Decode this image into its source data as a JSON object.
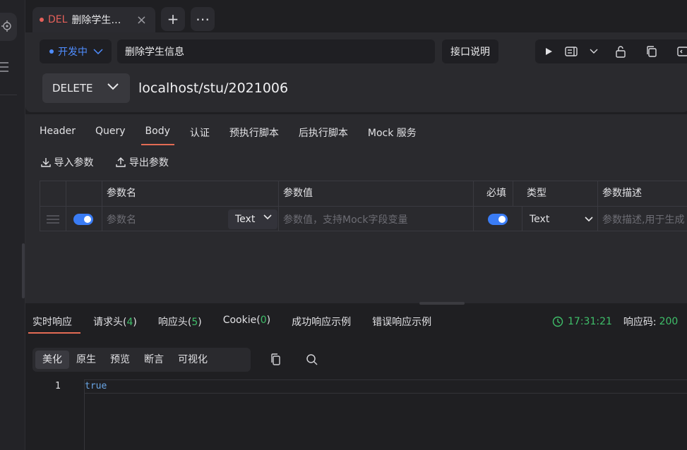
{
  "tab": {
    "method": "DEL",
    "name": "删除学生…",
    "close_icon": "×"
  },
  "tab_actions": {
    "add": "+",
    "more": "⋯"
  },
  "request": {
    "status": "开发中",
    "name_value": "删除学生信息",
    "doc_button": "接口说明",
    "http_method": "DELETE",
    "url_value": "localhost/stu/2021006"
  },
  "subtabs": [
    "Header",
    "Query",
    "Body",
    "认证",
    "预执行脚本",
    "后执行脚本",
    "Mock 服务"
  ],
  "subtabs_active": "Body",
  "params_actions": {
    "import": "导入参数",
    "export": "导出参数"
  },
  "params_table": {
    "headers": {
      "name": "参数名",
      "value": "参数值",
      "required": "必填",
      "type": "类型",
      "desc": "参数描述"
    },
    "row": {
      "name_placeholder": "参数名",
      "name_type": "Text",
      "value_placeholder": "参数值，支持Mock字段变量",
      "type": "Text",
      "desc_placeholder": "参数描述,用于生成"
    }
  },
  "response": {
    "tabs": [
      {
        "label": "实时响应"
      },
      {
        "label": "请求头(",
        "count": "4",
        "suffix": ")"
      },
      {
        "label": "响应头(",
        "count": "5",
        "suffix": ")"
      },
      {
        "label": "Cookie(",
        "count": "0",
        "suffix": ")"
      },
      {
        "label": "成功响应示例"
      },
      {
        "label": "错误响应示例"
      }
    ],
    "time": "17:31:21",
    "code_label": "响应码:",
    "code": "200",
    "views": [
      "美化",
      "原生",
      "预览",
      "断言",
      "可视化"
    ],
    "active_view": "美化",
    "line_number": "1",
    "body": "true"
  },
  "colors": {
    "accent": "#e36b54",
    "success": "#3fbf6a",
    "primary": "#3a7cf5",
    "delete": "#e5605a"
  }
}
